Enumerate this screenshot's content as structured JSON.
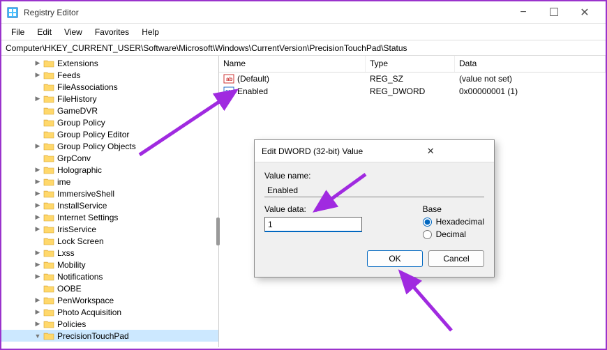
{
  "window": {
    "title": "Registry Editor",
    "minimize": "−",
    "maximize": "☐",
    "close": "✕"
  },
  "menu": [
    "File",
    "Edit",
    "View",
    "Favorites",
    "Help"
  ],
  "address": "Computer\\HKEY_CURRENT_USER\\Software\\Microsoft\\Windows\\CurrentVersion\\PrecisionTouchPad\\Status",
  "tree": [
    {
      "label": "Extensions",
      "expand": ">"
    },
    {
      "label": "Feeds",
      "expand": ">"
    },
    {
      "label": "FileAssociations",
      "expand": ""
    },
    {
      "label": "FileHistory",
      "expand": ">"
    },
    {
      "label": "GameDVR",
      "expand": ""
    },
    {
      "label": "Group Policy",
      "expand": ""
    },
    {
      "label": "Group Policy Editor",
      "expand": ""
    },
    {
      "label": "Group Policy Objects",
      "expand": ">"
    },
    {
      "label": "GrpConv",
      "expand": ""
    },
    {
      "label": "Holographic",
      "expand": ">"
    },
    {
      "label": "ime",
      "expand": ">"
    },
    {
      "label": "ImmersiveShell",
      "expand": ">"
    },
    {
      "label": "InstallService",
      "expand": ">"
    },
    {
      "label": "Internet Settings",
      "expand": ">"
    },
    {
      "label": "IrisService",
      "expand": ">"
    },
    {
      "label": "Lock Screen",
      "expand": ""
    },
    {
      "label": "Lxss",
      "expand": ">"
    },
    {
      "label": "Mobility",
      "expand": ">"
    },
    {
      "label": "Notifications",
      "expand": ">"
    },
    {
      "label": "OOBE",
      "expand": ""
    },
    {
      "label": "PenWorkspace",
      "expand": ">"
    },
    {
      "label": "Photo Acquisition",
      "expand": ">"
    },
    {
      "label": "Policies",
      "expand": ">"
    },
    {
      "label": "PrecisionTouchPad",
      "expand": "v",
      "selected": true
    }
  ],
  "list": {
    "headers": {
      "name": "Name",
      "type": "Type",
      "data": "Data"
    },
    "rows": [
      {
        "icon": "string",
        "name": "(Default)",
        "type": "REG_SZ",
        "data": "(value not set)"
      },
      {
        "icon": "dword",
        "name": "Enabled",
        "type": "REG_DWORD",
        "data": "0x00000001 (1)"
      }
    ]
  },
  "dialog": {
    "title": "Edit DWORD (32-bit) Value",
    "name_label": "Value name:",
    "name_value": "Enabled",
    "data_label": "Value data:",
    "data_value": "1",
    "base_label": "Base",
    "hex_label": "Hexadecimal",
    "dec_label": "Decimal",
    "ok": "OK",
    "cancel": "Cancel"
  }
}
